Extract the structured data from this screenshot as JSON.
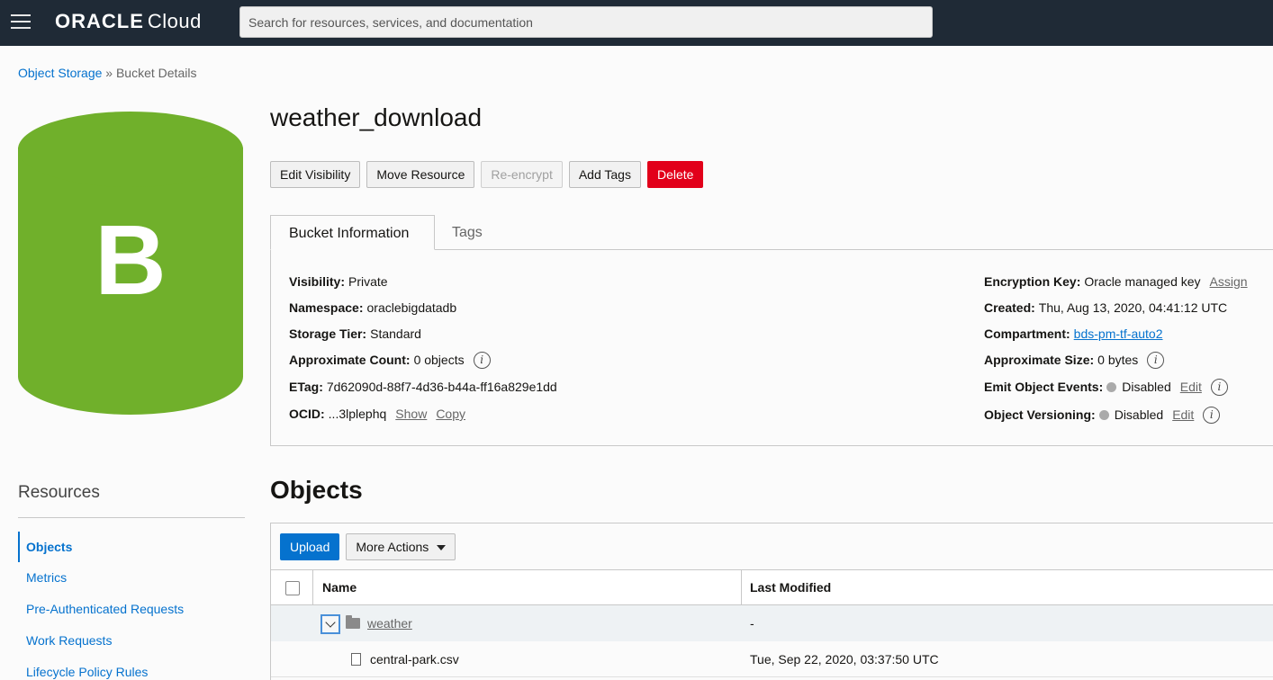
{
  "topbar": {
    "brand": "ORACLE",
    "product": "Cloud",
    "search_placeholder": "Search for resources, services, and documentation"
  },
  "breadcrumb": {
    "root": "Object Storage",
    "separator": "»",
    "current": "Bucket Details"
  },
  "bucket_icon_letter": "B",
  "page_title": "weather_download",
  "actions": {
    "edit_visibility": "Edit Visibility",
    "move_resource": "Move Resource",
    "re_encrypt": "Re-encrypt",
    "add_tags": "Add Tags",
    "delete": "Delete"
  },
  "info_tabs": {
    "bucket_information": "Bucket Information",
    "tags": "Tags"
  },
  "info": {
    "visibility": {
      "label": "Visibility:",
      "value": "Private"
    },
    "namespace": {
      "label": "Namespace:",
      "value": "oraclebigdatadb"
    },
    "storage_tier": {
      "label": "Storage Tier:",
      "value": "Standard"
    },
    "approximate_count": {
      "label": "Approximate Count:",
      "value": "0 objects"
    },
    "etag": {
      "label": "ETag:",
      "value": "7d62090d-88f7-4d36-b44a-ff16a829e1dd"
    },
    "ocid": {
      "label": "OCID:",
      "value": "...3lplephq",
      "show": "Show",
      "copy": "Copy"
    },
    "encryption_key": {
      "label": "Encryption Key:",
      "value": "Oracle managed key",
      "action": "Assign"
    },
    "created": {
      "label": "Created:",
      "value": "Thu, Aug 13, 2020, 04:41:12 UTC"
    },
    "compartment": {
      "label": "Compartment:",
      "value": "bds-pm-tf-auto2"
    },
    "approximate_size": {
      "label": "Approximate Size:",
      "value": "0 bytes"
    },
    "emit_object_events": {
      "label": "Emit Object Events:",
      "value": "Disabled",
      "action": "Edit"
    },
    "object_versioning": {
      "label": "Object Versioning:",
      "value": "Disabled",
      "action": "Edit"
    },
    "info_glyph": "i"
  },
  "resources": {
    "title": "Resources",
    "items": [
      "Objects",
      "Metrics",
      "Pre-Authenticated Requests",
      "Work Requests",
      "Lifecycle Policy Rules"
    ]
  },
  "objects": {
    "title": "Objects",
    "upload": "Upload",
    "more_actions": "More Actions",
    "columns": {
      "name": "Name",
      "last_modified": "Last Modified"
    },
    "rows": [
      {
        "name": "weather",
        "last_modified": "-",
        "type": "folder"
      },
      {
        "name": "central-park.csv",
        "last_modified": "Tue, Sep 22, 2020, 03:37:50 UTC",
        "type": "file"
      }
    ]
  },
  "colors": {
    "topbar": "#1f2a36",
    "bucket_green": "#70b02b",
    "link_blue": "#0572ce",
    "danger_red": "#e2001a",
    "status_gray": "#aaaaaa"
  }
}
